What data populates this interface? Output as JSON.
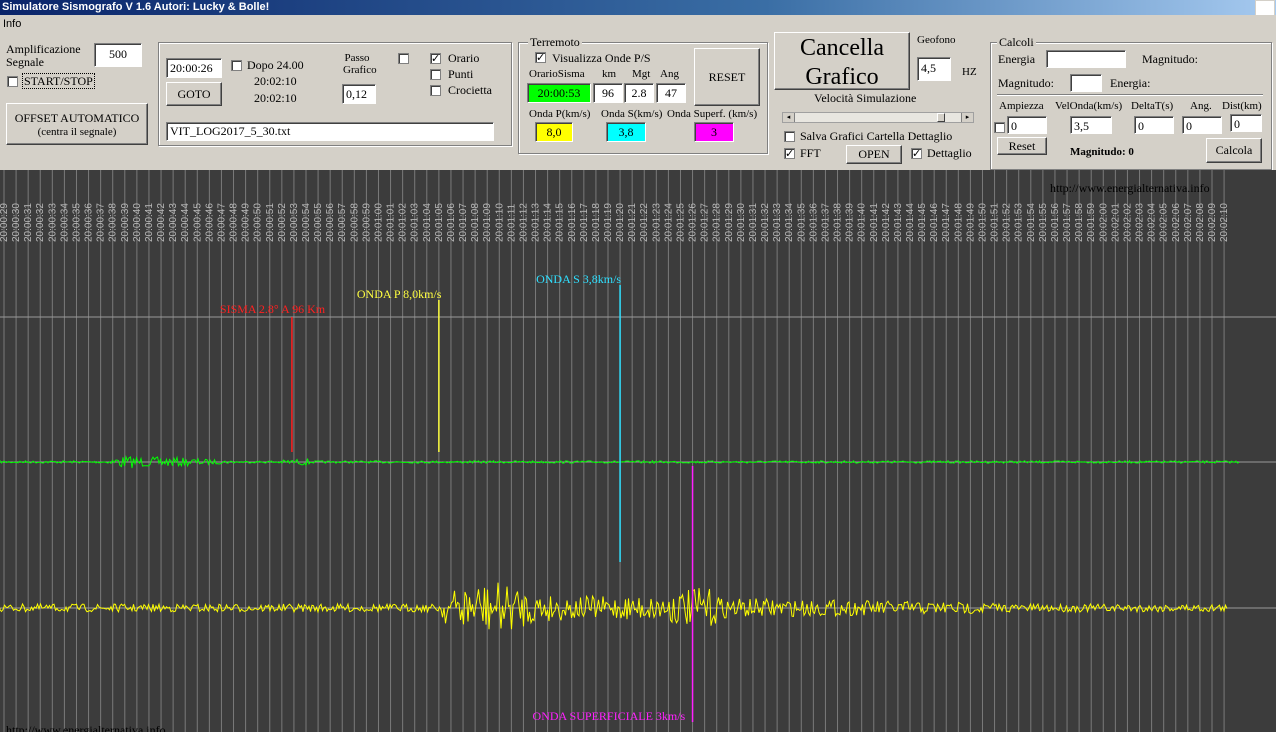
{
  "window": {
    "title": "Simulatore Sismografo V 1.6  Autori: Lucky & Bolle!"
  },
  "menu": {
    "info": "Info"
  },
  "amplificazione": {
    "label": "Amplificazione Segnale",
    "value": "500",
    "start_stop": "START/STOP",
    "offset_label": "OFFSET AUTOMATICO",
    "offset_sub": "(centra il segnale)"
  },
  "time_controls": {
    "time": "20:00:26",
    "dopo_label": "Dopo 24.00",
    "time_a": "20:02:10",
    "time_b": "20:02:10",
    "goto": "GOTO",
    "passo_label_1": "Passo",
    "passo_label_2": "Grafico",
    "passo_value": "0,12",
    "orario": "Orario",
    "punti": "Punti",
    "crocietta": "Crocietta",
    "file": "VIT_LOG2017_5_30.txt"
  },
  "terremoto": {
    "legend": "Terremoto",
    "visualizza": "Visualizza Onde P/S",
    "col_orario": "OrarioSisma",
    "col_km": "km",
    "col_mgt": "Mgt",
    "col_ang": "Ang",
    "orario_value": "20:00:53",
    "km_value": "96",
    "mgt_value": "2.8",
    "ang_value": "47",
    "reset": "RESET",
    "onda_p_label": "Onda P(km/s)",
    "onda_s_label": "Onda S(km/s)",
    "onda_sup_label": "Onda Superf. (km/s)",
    "onda_p_value": "8,0",
    "onda_s_value": "3,8",
    "onda_sup_value": "3"
  },
  "cancella": {
    "line1": "Cancella",
    "line2": "Grafico",
    "velocita": "Velocità Simulazione",
    "slider_pos": 0.88,
    "salva": "Salva Grafici Cartella Dettaglio",
    "fft": "FFT",
    "open": "OPEN",
    "dettaglio": "Dettaglio"
  },
  "geofono": {
    "label": "Geofono",
    "value": "4,5",
    "unit": "HZ"
  },
  "calcoli": {
    "legend": "Calcoli",
    "energia": "Energia",
    "magnitudo_colon": "Magnitudo:",
    "magnitudo2": "Magnitudo:",
    "energia2": "Energia:",
    "h_ampiezza": "Ampiezza",
    "h_velonda": "VelOnda(km/s)",
    "h_deltat": "DeltaT(s)",
    "h_ang": "Ang.",
    "h_dist": "Dist(km)",
    "v_ampiezza": "0",
    "v_velonda": "3,5",
    "v_deltat": "0",
    "v_ang": "0",
    "v_dist": "0",
    "reset": "Reset",
    "magnitudo_result": "Magnitudo: 0",
    "calcola": "Calcola"
  },
  "graph": {
    "website": "http://www.energialternativa.info",
    "website_bottom": "http://www.energialternativa.info",
    "labels_start_sec": 29,
    "labels_end_sec": 130,
    "markers": [
      {
        "label": "SISMA 2.8° A 96 Km",
        "color": "#ff2020",
        "time": "20:00:53"
      },
      {
        "label": "ONDA P 8,0km/s",
        "color": "#ffff40",
        "time": "20:01:05"
      },
      {
        "label": "ONDA S 3,8km/s",
        "color": "#30e0ff",
        "time": "20:01:20"
      },
      {
        "label": "ONDA SUPERFICIALE 3km/s",
        "color": "#ff20ff",
        "time": "20:01:26"
      }
    ],
    "trace_colors": [
      "#00ff00",
      "#ffff00"
    ]
  }
}
